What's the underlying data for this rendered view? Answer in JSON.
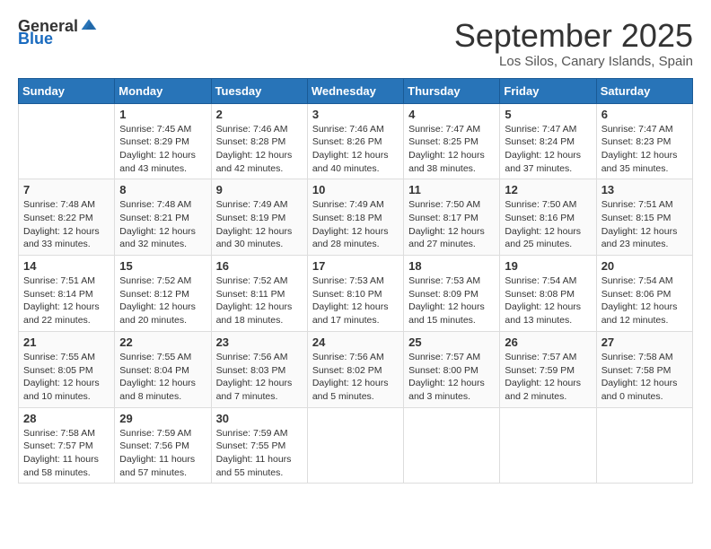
{
  "header": {
    "logo_general": "General",
    "logo_blue": "Blue",
    "month_title": "September 2025",
    "subtitle": "Los Silos, Canary Islands, Spain"
  },
  "weekdays": [
    "Sunday",
    "Monday",
    "Tuesday",
    "Wednesday",
    "Thursday",
    "Friday",
    "Saturday"
  ],
  "weeks": [
    [
      {
        "day": null
      },
      {
        "day": "1",
        "sunrise": "7:45 AM",
        "sunset": "8:29 PM",
        "daylight": "12 hours and 43 minutes."
      },
      {
        "day": "2",
        "sunrise": "7:46 AM",
        "sunset": "8:28 PM",
        "daylight": "12 hours and 42 minutes."
      },
      {
        "day": "3",
        "sunrise": "7:46 AM",
        "sunset": "8:26 PM",
        "daylight": "12 hours and 40 minutes."
      },
      {
        "day": "4",
        "sunrise": "7:47 AM",
        "sunset": "8:25 PM",
        "daylight": "12 hours and 38 minutes."
      },
      {
        "day": "5",
        "sunrise": "7:47 AM",
        "sunset": "8:24 PM",
        "daylight": "12 hours and 37 minutes."
      },
      {
        "day": "6",
        "sunrise": "7:47 AM",
        "sunset": "8:23 PM",
        "daylight": "12 hours and 35 minutes."
      }
    ],
    [
      {
        "day": "7",
        "sunrise": "7:48 AM",
        "sunset": "8:22 PM",
        "daylight": "12 hours and 33 minutes."
      },
      {
        "day": "8",
        "sunrise": "7:48 AM",
        "sunset": "8:21 PM",
        "daylight": "12 hours and 32 minutes."
      },
      {
        "day": "9",
        "sunrise": "7:49 AM",
        "sunset": "8:19 PM",
        "daylight": "12 hours and 30 minutes."
      },
      {
        "day": "10",
        "sunrise": "7:49 AM",
        "sunset": "8:18 PM",
        "daylight": "12 hours and 28 minutes."
      },
      {
        "day": "11",
        "sunrise": "7:50 AM",
        "sunset": "8:17 PM",
        "daylight": "12 hours and 27 minutes."
      },
      {
        "day": "12",
        "sunrise": "7:50 AM",
        "sunset": "8:16 PM",
        "daylight": "12 hours and 25 minutes."
      },
      {
        "day": "13",
        "sunrise": "7:51 AM",
        "sunset": "8:15 PM",
        "daylight": "12 hours and 23 minutes."
      }
    ],
    [
      {
        "day": "14",
        "sunrise": "7:51 AM",
        "sunset": "8:14 PM",
        "daylight": "12 hours and 22 minutes."
      },
      {
        "day": "15",
        "sunrise": "7:52 AM",
        "sunset": "8:12 PM",
        "daylight": "12 hours and 20 minutes."
      },
      {
        "day": "16",
        "sunrise": "7:52 AM",
        "sunset": "8:11 PM",
        "daylight": "12 hours and 18 minutes."
      },
      {
        "day": "17",
        "sunrise": "7:53 AM",
        "sunset": "8:10 PM",
        "daylight": "12 hours and 17 minutes."
      },
      {
        "day": "18",
        "sunrise": "7:53 AM",
        "sunset": "8:09 PM",
        "daylight": "12 hours and 15 minutes."
      },
      {
        "day": "19",
        "sunrise": "7:54 AM",
        "sunset": "8:08 PM",
        "daylight": "12 hours and 13 minutes."
      },
      {
        "day": "20",
        "sunrise": "7:54 AM",
        "sunset": "8:06 PM",
        "daylight": "12 hours and 12 minutes."
      }
    ],
    [
      {
        "day": "21",
        "sunrise": "7:55 AM",
        "sunset": "8:05 PM",
        "daylight": "12 hours and 10 minutes."
      },
      {
        "day": "22",
        "sunrise": "7:55 AM",
        "sunset": "8:04 PM",
        "daylight": "12 hours and 8 minutes."
      },
      {
        "day": "23",
        "sunrise": "7:56 AM",
        "sunset": "8:03 PM",
        "daylight": "12 hours and 7 minutes."
      },
      {
        "day": "24",
        "sunrise": "7:56 AM",
        "sunset": "8:02 PM",
        "daylight": "12 hours and 5 minutes."
      },
      {
        "day": "25",
        "sunrise": "7:57 AM",
        "sunset": "8:00 PM",
        "daylight": "12 hours and 3 minutes."
      },
      {
        "day": "26",
        "sunrise": "7:57 AM",
        "sunset": "7:59 PM",
        "daylight": "12 hours and 2 minutes."
      },
      {
        "day": "27",
        "sunrise": "7:58 AM",
        "sunset": "7:58 PM",
        "daylight": "12 hours and 0 minutes."
      }
    ],
    [
      {
        "day": "28",
        "sunrise": "7:58 AM",
        "sunset": "7:57 PM",
        "daylight": "11 hours and 58 minutes."
      },
      {
        "day": "29",
        "sunrise": "7:59 AM",
        "sunset": "7:56 PM",
        "daylight": "11 hours and 57 minutes."
      },
      {
        "day": "30",
        "sunrise": "7:59 AM",
        "sunset": "7:55 PM",
        "daylight": "11 hours and 55 minutes."
      },
      {
        "day": null
      },
      {
        "day": null
      },
      {
        "day": null
      },
      {
        "day": null
      }
    ]
  ],
  "labels": {
    "sunrise": "Sunrise:",
    "sunset": "Sunset:",
    "daylight": "Daylight:"
  }
}
